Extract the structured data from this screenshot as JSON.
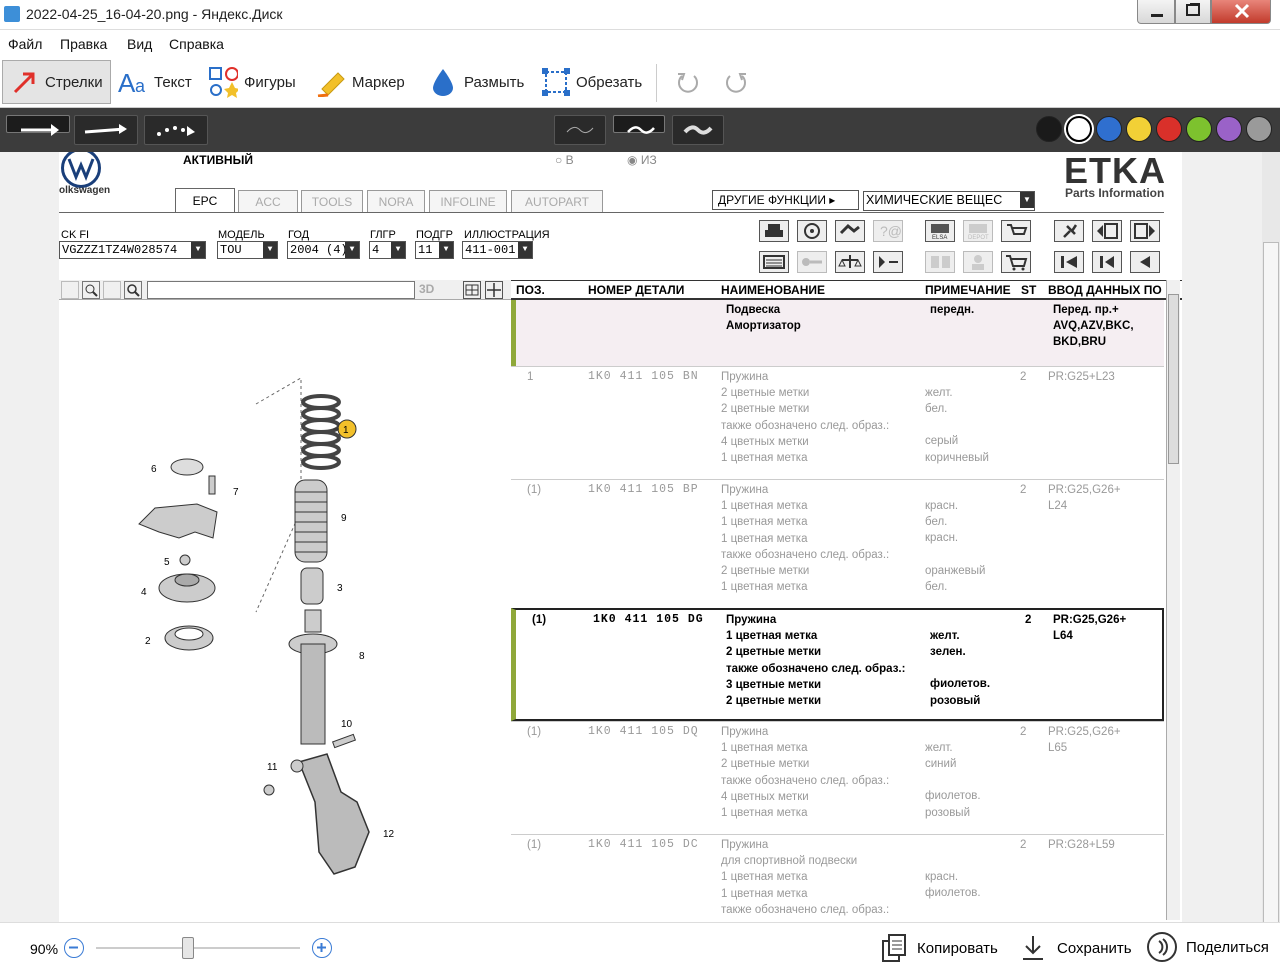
{
  "window": {
    "title": "2022-04-25_16-04-20.png - Яндекс.Диск"
  },
  "menu": [
    "Файл",
    "Правка",
    "Вид",
    "Справка"
  ],
  "tools": {
    "arrows": "Стрелки",
    "text": "Текст",
    "shapes": "Фигуры",
    "marker": "Маркер",
    "blur": "Размыть",
    "crop": "Обрезать"
  },
  "colors": [
    "#1a1a1a",
    "#ffffff",
    "#2f6fcf",
    "#f2d036",
    "#d9302a",
    "#7dc22e",
    "#9a62c8",
    "#9a9a9a"
  ],
  "etka": {
    "status": "АКТИВНЫЙ",
    "radio_in": "В",
    "radio_out": "ИЗ",
    "brand": "olkswagen",
    "logo": "ETKA",
    "logo_sub": "Parts Information",
    "tabs": [
      "EPC",
      "ACC",
      "TOOLS",
      "NORA",
      "INFOLINE",
      "AUTOPART"
    ],
    "other_functions": "ДРУГИЕ ФУНКЦИИ",
    "chem": "ХИМИЧЕСКИЕ ВЕЩЕС",
    "fields": {
      "vin_label": "CK FI",
      "vin": "VGZZZ1TZ4W028574",
      "model_label": "МОДЕЛЬ",
      "model": "TOU",
      "year_label": "ГОД",
      "year": "2004 (4)",
      "group_label": "ГЛГР",
      "group": "4",
      "subgroup_label": "ПОДГР",
      "subgroup": "11",
      "illus_label": "ИЛЛЮСТРАЦИЯ",
      "illus": "411-001"
    },
    "icon_labels": {
      "elsa": "ELSA",
      "depot": "DEPOT"
    },
    "threed": "3D",
    "headers": {
      "pos": "ПОЗ.",
      "part": "НОМЕР ДЕТАЛИ",
      "name": "НАИМЕНОВАНИЕ",
      "note": "ПРИМЕЧАНИЕ",
      "st": "ST",
      "data": "ВВОД ДАННЫХ ПО"
    },
    "callouts": [
      "1",
      "6",
      "7",
      "9",
      "5",
      "4",
      "3",
      "2",
      "8",
      "10",
      "11",
      "12"
    ],
    "rows": [
      {
        "pos": "",
        "part": "",
        "names": [
          "Подвеска",
          "Амортизатор"
        ],
        "notes": [
          "передн.",
          ""
        ],
        "st": "",
        "data": [
          "Перед. пр.+",
          "AVQ,AZV,BKC,",
          "BKD,BRU"
        ],
        "style": "header"
      },
      {
        "pos": "1",
        "part": "1K0  411  105  BN",
        "names": [
          "Пружина",
          "2 цветные метки",
          "2 цветные метки",
          "также обозначено след. образ.:",
          "4 цветных метки",
          "1 цветная метка"
        ],
        "notes": [
          "",
          "желт.",
          "бел.",
          "",
          "серый",
          "коричневый"
        ],
        "st": "2",
        "data": [
          "PR:G25+L23"
        ],
        "style": "grey"
      },
      {
        "pos": "(1)",
        "part": "1K0  411  105  BP",
        "names": [
          "Пружина",
          "1 цветная метка",
          "1 цветная метка",
          "1 цветная метка",
          "также обозначено след. образ.:",
          "2 цветные метки",
          "1 цветная метка"
        ],
        "notes": [
          "",
          "красн.",
          "бел.",
          "красн.",
          "",
          "оранжевый",
          "бел."
        ],
        "st": "2",
        "data": [
          "PR:G25,G26+",
          "L24"
        ],
        "style": "grey"
      },
      {
        "pos": "(1)",
        "part": "1K0  411  105  DG",
        "names": [
          "Пружина",
          "1 цветная метка",
          "2 цветные метки",
          "также обозначено след. образ.:",
          "3 цветные метки",
          "2 цветные метки"
        ],
        "notes": [
          "",
          "желт.",
          "зелен.",
          "",
          "фиолетов.",
          "розовый"
        ],
        "st": "2",
        "data": [
          "PR:G25,G26+",
          "L64"
        ],
        "style": "selected"
      },
      {
        "pos": "(1)",
        "part": "1K0  411  105  DQ",
        "names": [
          "Пружина",
          "1 цветная метка",
          "2 цветные метки",
          "также обозначено след. образ.:",
          "4 цветных метки",
          "1 цветная метка"
        ],
        "notes": [
          "",
          "желт.",
          "синий",
          "",
          "фиолетов.",
          "розовый"
        ],
        "st": "2",
        "data": [
          "PR:G25,G26+",
          "L65"
        ],
        "style": "grey"
      },
      {
        "pos": "(1)",
        "part": "1K0  411  105  DC",
        "names": [
          "Пружина",
          "для спортивной подвески",
          "1 цветная метка",
          "1 цветная метка",
          "также обозначено след. образ.:"
        ],
        "notes": [
          "",
          "",
          "красн.",
          "фиолетов.",
          ""
        ],
        "st": "2",
        "data": [
          "PR:G28+L59"
        ],
        "style": "grey"
      }
    ]
  },
  "status": {
    "zoom": "90%",
    "copy": "Копировать",
    "save": "Сохранить",
    "share": "Поделиться",
    "zoom_level": 0.45
  }
}
